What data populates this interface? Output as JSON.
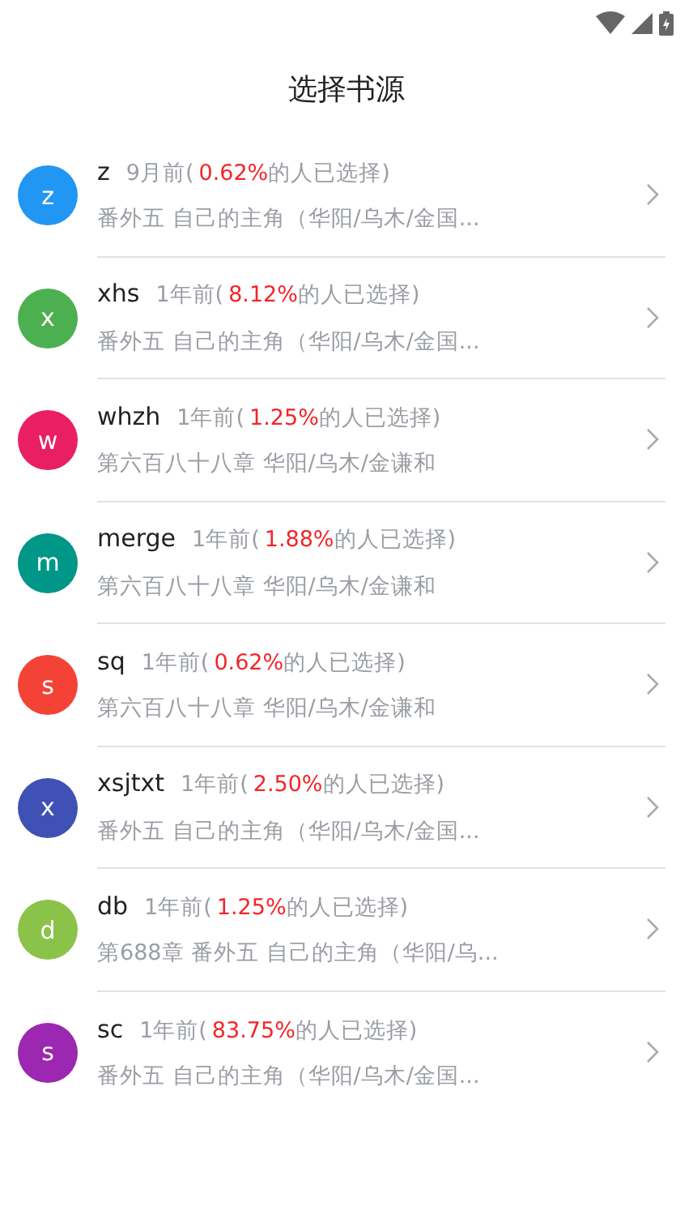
{
  "app_bar": {
    "title": "选择书源"
  },
  "sources": [
    {
      "initial": "z",
      "color": "#2196f3",
      "name": "z",
      "age": "9月前(",
      "percent": "0.62%",
      "suffix": "的人已选择)",
      "latest": "番外五 自己的主角（华阳/乌木/金国..."
    },
    {
      "initial": "x",
      "color": "#4caf50",
      "name": "xhs",
      "age": "1年前(",
      "percent": "8.12%",
      "suffix": "的人已选择)",
      "latest": "番外五 自己的主角（华阳/乌木/金国..."
    },
    {
      "initial": "w",
      "color": "#e91e63",
      "name": "whzh",
      "age": "1年前(",
      "percent": "1.25%",
      "suffix": "的人已选择)",
      "latest": "第六百八十八章 华阳/乌木/金谦和"
    },
    {
      "initial": "m",
      "color": "#009688",
      "name": "merge",
      "age": "1年前(",
      "percent": "1.88%",
      "suffix": "的人已选择)",
      "latest": "第六百八十八章 华阳/乌木/金谦和"
    },
    {
      "initial": "s",
      "color": "#f44336",
      "name": "sq",
      "age": "1年前(",
      "percent": "0.62%",
      "suffix": "的人已选择)",
      "latest": "第六百八十八章 华阳/乌木/金谦和"
    },
    {
      "initial": "x",
      "color": "#3f51b5",
      "name": "xsjtxt",
      "age": "1年前(",
      "percent": "2.50%",
      "suffix": "的人已选择)",
      "latest": "番外五 自己的主角（华阳/乌木/金国..."
    },
    {
      "initial": "d",
      "color": "#8bc34a",
      "name": "db",
      "age": "1年前(",
      "percent": "1.25%",
      "suffix": "的人已选择)",
      "latest": "第688章 番外五 自己的主角（华阳/乌..."
    },
    {
      "initial": "s",
      "color": "#9c27b0",
      "name": "sc",
      "age": "1年前(",
      "percent": "83.75%",
      "suffix": "的人已选择)",
      "latest": "番外五 自己的主角（华阳/乌木/金国..."
    }
  ]
}
